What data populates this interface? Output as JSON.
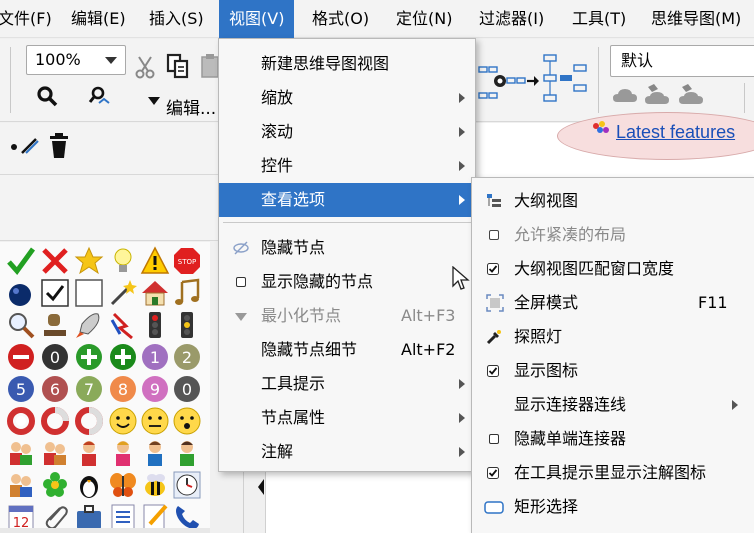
{
  "menubar": [
    {
      "label": "文件(F)"
    },
    {
      "label": "编辑(E)"
    },
    {
      "label": "插入(S)"
    },
    {
      "label": "视图(V)"
    },
    {
      "label": "格式(O)"
    },
    {
      "label": "定位(N)"
    },
    {
      "label": "过滤器(I)"
    },
    {
      "label": "工具(T)"
    },
    {
      "label": "思维导图(M)"
    }
  ],
  "toolbar": {
    "zoom_value": "100%",
    "edit_label": "编辑...",
    "style_value": "默认"
  },
  "map": {
    "latest_features": "Latest features"
  },
  "view_menu": {
    "items": [
      {
        "label": "新建思维导图视图"
      },
      {
        "label": "缩放"
      },
      {
        "label": "滚动"
      },
      {
        "label": "控件"
      },
      {
        "label": "查看选项"
      },
      {
        "label": "隐藏节点"
      },
      {
        "label": "显示隐藏的节点"
      },
      {
        "label": "最小化节点",
        "shortcut": "Alt+F3"
      },
      {
        "label": "隐藏节点细节",
        "shortcut": "Alt+F2"
      },
      {
        "label": "工具提示"
      },
      {
        "label": "节点属性"
      },
      {
        "label": "注解"
      }
    ]
  },
  "view_options_menu": {
    "items": [
      {
        "label": "大纲视图"
      },
      {
        "label": "允许紧凑的布局"
      },
      {
        "label": "大纲视图匹配窗口宽度"
      },
      {
        "label": "全屏模式",
        "shortcut": "F11"
      },
      {
        "label": "探照灯"
      },
      {
        "label": "显示图标"
      },
      {
        "label": "显示连接器连线"
      },
      {
        "label": "隐藏单端连接器"
      },
      {
        "label": "在工具提示里显示注解图标"
      },
      {
        "label": "矩形选择"
      }
    ]
  },
  "colors": {
    "highlight": "#2f74c6",
    "menu_bg": "#f7f7f7",
    "link": "#1a4fb8"
  }
}
